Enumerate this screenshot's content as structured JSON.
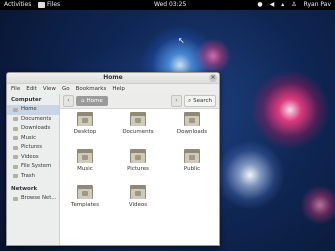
{
  "topbar": {
    "activities": "Activities",
    "app_name": "Files",
    "clock": "Wed 03:25",
    "user": "Ryan Pav"
  },
  "window": {
    "title": "Home",
    "menu": [
      "File",
      "Edit",
      "View",
      "Go",
      "Bookmarks",
      "Help"
    ],
    "path": "Home",
    "search_label": "Search"
  },
  "sidebar": {
    "computer_heading": "Computer",
    "computer_items": [
      "Home",
      "Documents",
      "Downloads",
      "Music",
      "Pictures",
      "Videos",
      "File System",
      "Trash"
    ],
    "network_heading": "Network",
    "network_items": [
      "Browse Net..."
    ]
  },
  "files": [
    "Desktop",
    "Documents",
    "Downloads",
    "Music",
    "Pictures",
    "Public",
    "Templates",
    "Videos"
  ],
  "colors": {
    "panel": "#000000",
    "selection": "#c9d5e5",
    "folder": "#cfcbb8"
  }
}
